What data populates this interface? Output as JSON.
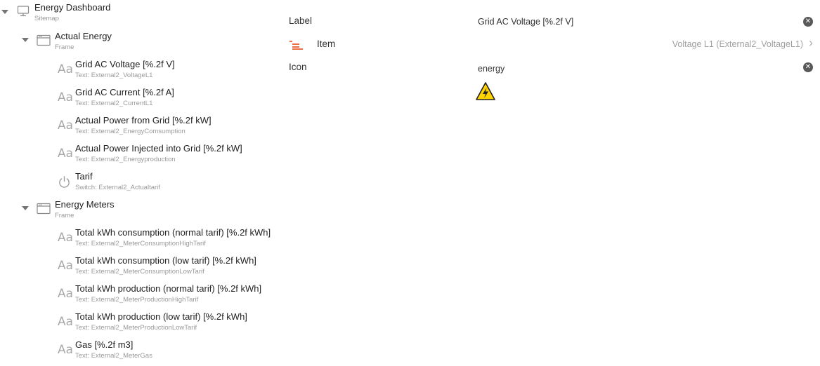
{
  "root": {
    "title": "Energy Dashboard",
    "subtitle": "Sitemap"
  },
  "frames": [
    {
      "title": "Actual Energy",
      "subtitle": "Frame",
      "widgets": [
        {
          "icon": "text-icon",
          "glyph": "Aa",
          "title": "Grid AC Voltage [%.2f V]",
          "subtitle": "Text: External2_VoltageL1"
        },
        {
          "icon": "text-icon",
          "glyph": "Aa",
          "title": "Grid AC Current [%.2f A]",
          "subtitle": "Text: External2_CurrentL1"
        },
        {
          "icon": "text-icon",
          "glyph": "Aa",
          "title": "Actual Power from Grid [%.2f kW]",
          "subtitle": "Text: External2_EnergyComsumption"
        },
        {
          "icon": "text-icon",
          "glyph": "Aa",
          "title": "Actual Power Injected into Grid [%.2f kW]",
          "subtitle": "Text: External2_Energyproduction"
        },
        {
          "icon": "power-icon",
          "glyph": "",
          "title": "Tarif",
          "subtitle": "Switch: External2_Actualtarif"
        }
      ]
    },
    {
      "title": "Energy Meters",
      "subtitle": "Frame",
      "widgets": [
        {
          "icon": "text-icon",
          "glyph": "Aa",
          "title": "Total kWh consumption (normal tarif) [%.2f kWh]",
          "subtitle": "Text: External2_MeterConsumptionHighTarif"
        },
        {
          "icon": "text-icon",
          "glyph": "Aa",
          "title": "Total kWh consumption (low tarif) [%.2f kWh]",
          "subtitle": "Text: External2_MeterConsumptionLowTarif"
        },
        {
          "icon": "text-icon",
          "glyph": "Aa",
          "title": "Total kWh production (normal tarif) [%.2f kWh]",
          "subtitle": "Text: External2_MeterProductionHighTarif"
        },
        {
          "icon": "text-icon",
          "glyph": "Aa",
          "title": "Total kWh production (low tarif) [%.2f kWh]",
          "subtitle": "Text: External2_MeterProductionLowTarif"
        },
        {
          "icon": "text-icon",
          "glyph": "Aa",
          "title": "Gas [%.2f m3]",
          "subtitle": "Text: External2_MeterGas"
        }
      ]
    }
  ],
  "detail": {
    "label": {
      "name": "Label",
      "value": "Grid AC Voltage [%.2f V]"
    },
    "item": {
      "name": "Item",
      "value": "Voltage L1 (External2_VoltageL1)"
    },
    "icon": {
      "name": "Icon",
      "value": "energy",
      "preview": "warning-lightning-icon"
    },
    "clear_glyph": "✕",
    "chevron_glyph": "›"
  },
  "colors": {
    "accent": "#e64a19",
    "warning_yellow": "#ffd200"
  }
}
